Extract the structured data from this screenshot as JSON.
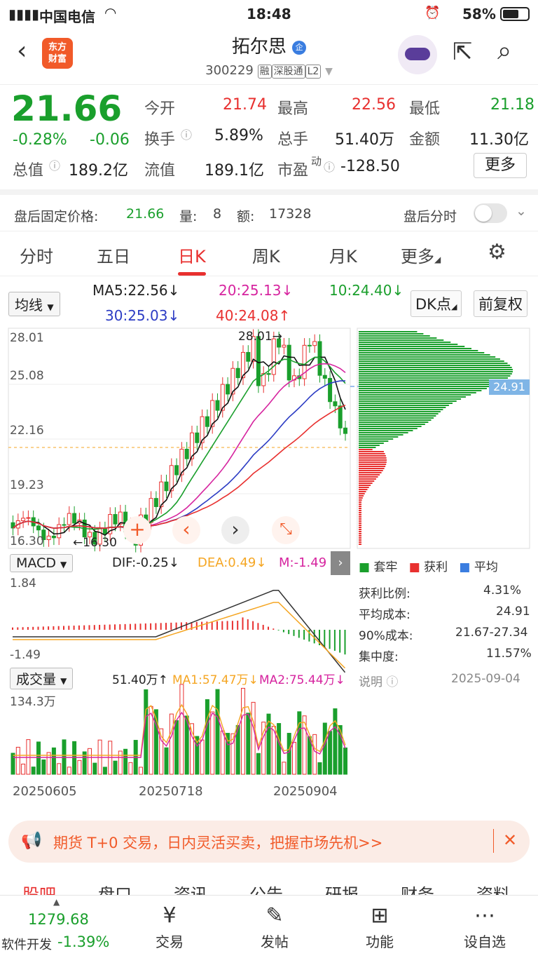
{
  "status": {
    "carrier": "中国电信",
    "time": "18:48",
    "battery": "58%"
  },
  "header": {
    "logo_line1": "东方",
    "logo_line2": "财富",
    "name": "拓尔思",
    "badge": "企",
    "code": "300229",
    "tags": [
      "融",
      "深股通",
      "L2"
    ]
  },
  "quote": {
    "price": "21.66",
    "pct": "-0.28%",
    "chg": "-0.06",
    "rows": [
      [
        {
          "l": "今开",
          "v": "21.74",
          "c": "red"
        },
        {
          "l": "最高",
          "v": "22.56",
          "c": "red"
        },
        {
          "l": "最低",
          "v": "21.18",
          "c": "green"
        }
      ],
      [
        {
          "l": "换手",
          "v": "5.89%",
          "c": ""
        },
        {
          "l": "总手",
          "v": "51.40万",
          "c": ""
        },
        {
          "l": "金额",
          "v": "11.30亿",
          "c": ""
        }
      ],
      [
        {
          "l": "流值",
          "v": "189.1亿",
          "c": ""
        },
        {
          "l": "市盈",
          "v": "-128.50",
          "c": ""
        }
      ]
    ],
    "total_label": "总值",
    "total_value": "189.2亿",
    "pe_sup": "动",
    "more": "更多"
  },
  "after_hours": {
    "label": "盘后固定价格:",
    "price": "21.66",
    "vol_label": "量:",
    "vol": "8",
    "amt_label": "额:",
    "amt": "17328",
    "timeshare": "盘后分时"
  },
  "tabs": [
    "分时",
    "五日",
    "日K",
    "周K",
    "月K",
    "更多",
    "settings-icon"
  ],
  "ma": {
    "select": "均线",
    "ma5": "MA5:22.56↓",
    "ma20": "20:25.13↓",
    "ma10": "10:24.40↓",
    "ma30": "30:25.03↓",
    "ma40": "40:24.08↑",
    "dk": "DK点",
    "fq": "前复权"
  },
  "kline": {
    "y_ticks": [
      "28.01",
      "25.08",
      "22.16",
      "19.23",
      "16.30"
    ],
    "max_label": "28.01→",
    "min_label": "←16.30",
    "cost_tag": "24.91"
  },
  "macd": {
    "select": "MACD",
    "dif": "DIF:-0.25↓",
    "dea": "DEA:0.49↓",
    "m": "M:-1.49",
    "top": "1.84",
    "bottom": "-1.49"
  },
  "volume": {
    "select": "成交量",
    "v": "51.40万↑",
    "ma1": "MA1:57.47万↓",
    "ma2": "MA2:75.44万↓",
    "top": "134.3万",
    "dates": [
      "20250605",
      "20250718",
      "20250904"
    ]
  },
  "chips": {
    "legend": [
      "套牢",
      "获利",
      "平均"
    ],
    "rows": [
      [
        "获利比例:",
        "4.31%"
      ],
      [
        "平均成本:",
        "24.91"
      ],
      [
        "90%成本:",
        "21.67-27.34"
      ],
      [
        "集中度:",
        "11.57%"
      ]
    ],
    "note": "说明",
    "date": "2025-09-04"
  },
  "ad": {
    "text": "期货 T+0 交易，日内灵活买卖，把握市场先机>>"
  },
  "ftabs": [
    "股吧",
    "盘口",
    "资讯",
    "公告",
    "研报",
    "财务",
    "资料"
  ],
  "bottom": {
    "index": "1279.68",
    "sector": "软件开发",
    "sector_pct": "-1.39%",
    "items": [
      "交易",
      "发帖",
      "功能",
      "设自选"
    ]
  },
  "colors": {
    "up": "#e8302f",
    "down": "#1a9f2c",
    "brand": "#f15a29"
  }
}
